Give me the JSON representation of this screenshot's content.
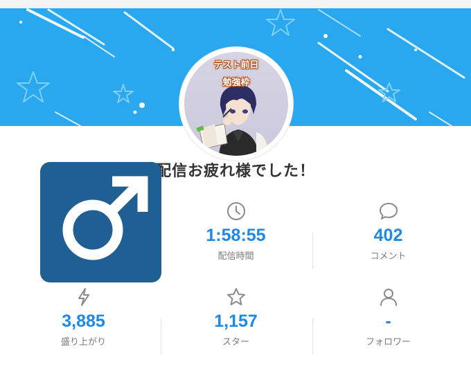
{
  "avatar": {
    "caption_line1": "テスト前日",
    "caption_line2": "勉強枠"
  },
  "message": "配信お疲れ様でした！",
  "stats": [
    {
      "icon": "clock-icon",
      "value": "1:58:55",
      "label": "配信時間"
    },
    {
      "icon": "comment-icon",
      "value": "402",
      "label": "コメント"
    },
    {
      "icon": "lightning-icon",
      "value": "3,885",
      "label": "盛り上がり"
    },
    {
      "icon": "star-icon",
      "value": "1,157",
      "label": "スター"
    },
    {
      "icon": "person-icon",
      "value": "-",
      "label": "フォロワー"
    }
  ],
  "overlay": {
    "icon": "male-symbol-icon"
  },
  "colors": {
    "banner": "#29a8ef",
    "value": "#1e88e5",
    "badge": "#1f5f93"
  }
}
